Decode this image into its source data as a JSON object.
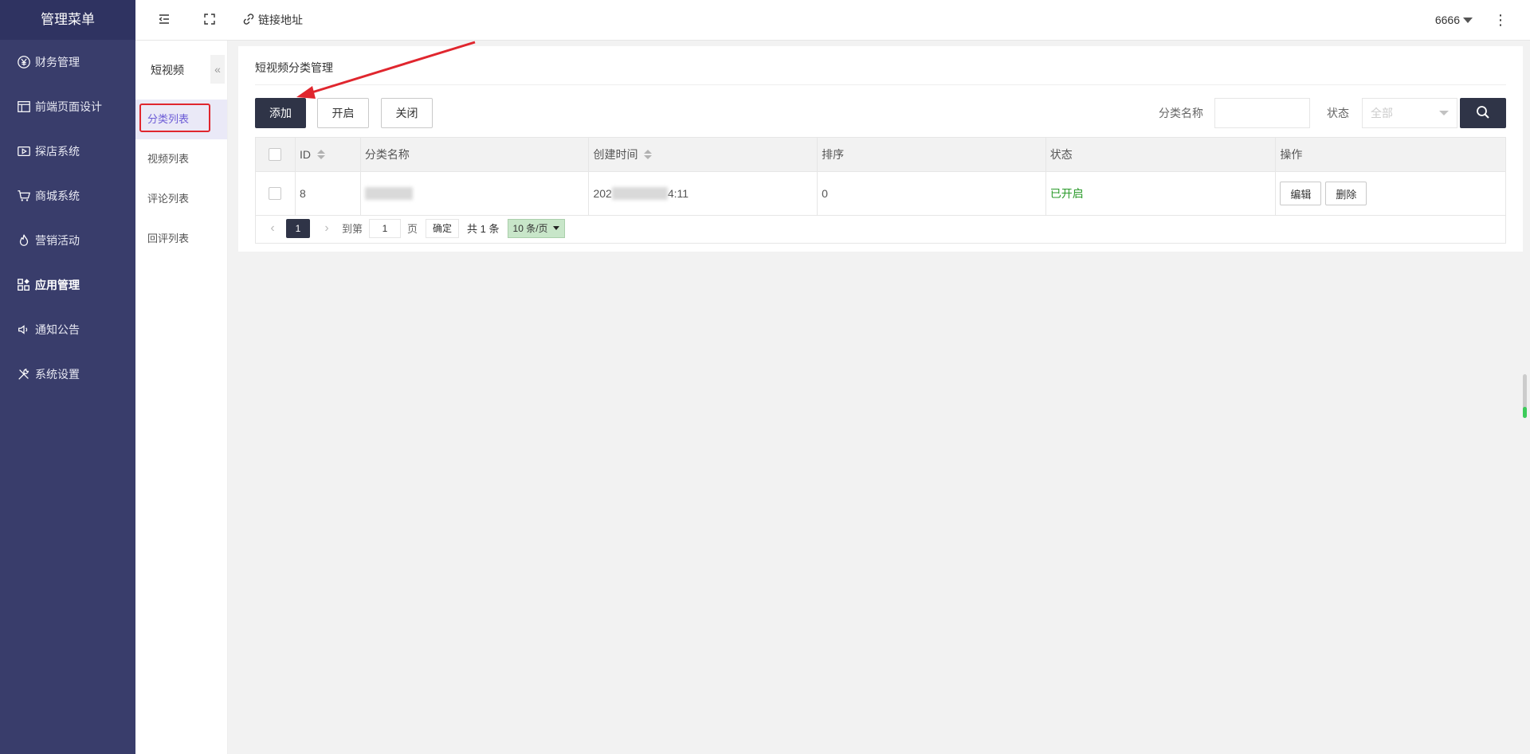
{
  "sidebar": {
    "title": "管理菜单",
    "items": [
      {
        "label": "财务管理",
        "icon": "yen-circle-icon"
      },
      {
        "label": "前端页面设计",
        "icon": "layout-icon"
      },
      {
        "label": "探店系统",
        "icon": "video-play-icon"
      },
      {
        "label": "商城系统",
        "icon": "cart-icon"
      },
      {
        "label": "营销活动",
        "icon": "fire-icon"
      },
      {
        "label": "应用管理",
        "icon": "apps-grid-icon"
      },
      {
        "label": "通知公告",
        "icon": "speaker-icon"
      },
      {
        "label": "系统设置",
        "icon": "tools-icon"
      }
    ]
  },
  "topbar": {
    "link_label": "链接地址",
    "user": "6666"
  },
  "subnav": {
    "title": "短视频",
    "items": [
      "分类列表",
      "视频列表",
      "评论列表",
      "回评列表"
    ]
  },
  "card": {
    "title": "短视频分类管理",
    "buttons": {
      "add": "添加",
      "open": "开启",
      "close": "关闭"
    },
    "filter": {
      "name_label": "分类名称",
      "name_value": "",
      "status_label": "状态",
      "status_value": "全部"
    }
  },
  "table": {
    "headers": [
      "ID",
      "分类名称",
      "创建时间",
      "排序",
      "状态",
      "操作"
    ],
    "rows": [
      {
        "id": "8",
        "name_prefix": "",
        "time_prefix": "202",
        "time_suffix": "4:11",
        "sort": "0",
        "status": "已开启",
        "edit": "编辑",
        "delete": "删除"
      }
    ]
  },
  "pager": {
    "current": "1",
    "goto_label": "到第",
    "goto_value": "1",
    "page_label": "页",
    "ok": "确定",
    "total": "共 1 条",
    "size": "10 条/页"
  },
  "colors": {
    "sidebar_bg": "#393d6b",
    "primary_btn": "#2f3447",
    "status_on": "#2a9a2a",
    "highlight": "#e0262e"
  }
}
